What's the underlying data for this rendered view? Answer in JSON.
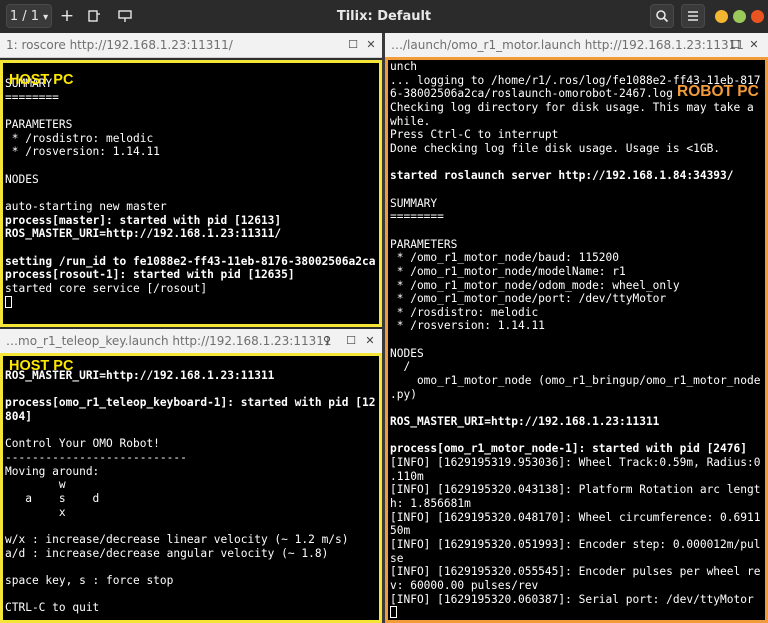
{
  "titlebar": {
    "session_label": "1 / 1",
    "session_arrow": "▾",
    "add_label": "+",
    "title": "Tilix: Default",
    "search_icon": "search-icon",
    "menu_icon": "menu-icon",
    "colors": {
      "minimize": "#f2b630",
      "maximize": "#9bca5a",
      "close": "#e95420"
    }
  },
  "panes": {
    "roscore": {
      "title": "1: roscore http://192.168.1.23:11311/",
      "label": "HOST PC",
      "lines": [
        {
          "t": "SUMMARY",
          "b": false
        },
        {
          "t": "========",
          "b": false
        },
        {
          "t": "",
          "b": false
        },
        {
          "t": "PARAMETERS",
          "b": false
        },
        {
          "t": " * /rosdistro: melodic",
          "b": false
        },
        {
          "t": " * /rosversion: 1.14.11",
          "b": false
        },
        {
          "t": "",
          "b": false
        },
        {
          "t": "NODES",
          "b": false
        },
        {
          "t": "",
          "b": false
        },
        {
          "t": "auto-starting new master",
          "b": false
        },
        {
          "t": "process[master]: started with pid [12613]",
          "b": true
        },
        {
          "t": "ROS_MASTER_URI=http://192.168.1.23:11311/",
          "b": true
        },
        {
          "t": "",
          "b": false
        },
        {
          "t": "setting /run_id to fe1088e2-ff43-11eb-8176-38002506a2ca",
          "b": true
        },
        {
          "t": "process[rosout-1]: started with pid [12635]",
          "b": true
        },
        {
          "t": "started core service [/rosout]",
          "b": false
        }
      ]
    },
    "teleop": {
      "title": "…mo_r1_teleop_key.launch http://192.168.1.23:11311",
      "label": "HOST PC",
      "lines": [
        {
          "t": "ROS_MASTER_URI=http://192.168.1.23:11311",
          "b": true
        },
        {
          "t": "",
          "b": false
        },
        {
          "t": "process[omo_r1_teleop_keyboard-1]: started with pid [12",
          "b": true
        },
        {
          "t": "804]",
          "b": true
        },
        {
          "t": "",
          "b": false
        },
        {
          "t": "Control Your OMO Robot!",
          "b": false
        },
        {
          "t": "---------------------------",
          "b": false
        },
        {
          "t": "Moving around:",
          "b": false
        },
        {
          "t": "        w",
          "b": false
        },
        {
          "t": "   a    s    d",
          "b": false
        },
        {
          "t": "        x",
          "b": false
        },
        {
          "t": "",
          "b": false
        },
        {
          "t": "w/x : increase/decrease linear velocity (~ 1.2 m/s)",
          "b": false
        },
        {
          "t": "a/d : increase/decrease angular velocity (~ 1.8)",
          "b": false
        },
        {
          "t": "",
          "b": false
        },
        {
          "t": "space key, s : force stop",
          "b": false
        },
        {
          "t": "",
          "b": false
        },
        {
          "t": "CTRL-C to quit",
          "b": false
        }
      ]
    },
    "motor": {
      "title": "…/launch/omo_r1_motor.launch http://192.168.1.23:11311",
      "label": "ROBOT PC",
      "lines": [
        {
          "t": "unch",
          "b": false
        },
        {
          "t": "... logging to /home/r1/.ros/log/fe1088e2-ff43-11eb-817",
          "b": false
        },
        {
          "t": "6-38002506a2ca/roslaunch-omorobot-2467.log",
          "b": false
        },
        {
          "t": "Checking log directory for disk usage. This may take a",
          "b": false
        },
        {
          "t": "while.",
          "b": false
        },
        {
          "t": "Press Ctrl-C to interrupt",
          "b": false
        },
        {
          "t": "Done checking log file disk usage. Usage is <1GB.",
          "b": false
        },
        {
          "t": "",
          "b": false
        },
        {
          "t": "started roslaunch server http://192.168.1.84:34393/",
          "b": true
        },
        {
          "t": "",
          "b": false
        },
        {
          "t": "SUMMARY",
          "b": false
        },
        {
          "t": "========",
          "b": false
        },
        {
          "t": "",
          "b": false
        },
        {
          "t": "PARAMETERS",
          "b": false
        },
        {
          "t": " * /omo_r1_motor_node/baud: 115200",
          "b": false
        },
        {
          "t": " * /omo_r1_motor_node/modelName: r1",
          "b": false
        },
        {
          "t": " * /omo_r1_motor_node/odom_mode: wheel_only",
          "b": false
        },
        {
          "t": " * /omo_r1_motor_node/port: /dev/ttyMotor",
          "b": false
        },
        {
          "t": " * /rosdistro: melodic",
          "b": false
        },
        {
          "t": " * /rosversion: 1.14.11",
          "b": false
        },
        {
          "t": "",
          "b": false
        },
        {
          "t": "NODES",
          "b": false
        },
        {
          "t": "  /",
          "b": false
        },
        {
          "t": "    omo_r1_motor_node (omo_r1_bringup/omo_r1_motor_node",
          "b": false
        },
        {
          "t": ".py)",
          "b": false
        },
        {
          "t": "",
          "b": false
        },
        {
          "t": "ROS_MASTER_URI=http://192.168.1.23:11311",
          "b": true
        },
        {
          "t": "",
          "b": false
        },
        {
          "t": "process[omo_r1_motor_node-1]: started with pid [2476]",
          "b": true
        },
        {
          "t": "[INFO] [1629195319.953036]: Wheel Track:0.59m, Radius:0",
          "b": false
        },
        {
          "t": ".110m",
          "b": false
        },
        {
          "t": "[INFO] [1629195320.043138]: Platform Rotation arc lengt",
          "b": false
        },
        {
          "t": "h: 1.856681m",
          "b": false
        },
        {
          "t": "[INFO] [1629195320.048170]: Wheel circumference: 0.6911",
          "b": false
        },
        {
          "t": "50m",
          "b": false
        },
        {
          "t": "[INFO] [1629195320.051993]: Encoder step: 0.000012m/pul",
          "b": false
        },
        {
          "t": "se",
          "b": false
        },
        {
          "t": "[INFO] [1629195320.055545]: Encoder pulses per wheel re",
          "b": false
        },
        {
          "t": "v: 60000.00 pulses/rev",
          "b": false
        },
        {
          "t": "[INFO] [1629195320.060387]: Serial port: /dev/ttyMotor",
          "b": false
        }
      ]
    }
  },
  "colors": {
    "host_border": "#f4e536",
    "robot_border": "#f29b3a"
  }
}
